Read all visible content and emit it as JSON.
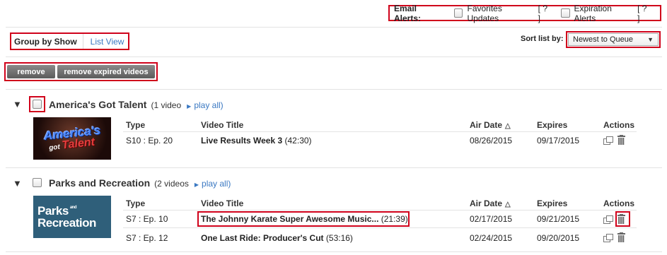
{
  "email_alerts": {
    "label": "Email Alerts:",
    "options": [
      {
        "label": "Favorites Updates",
        "help": "[ ? ]"
      },
      {
        "label": "Expiration Alerts",
        "help": "[ ? ]"
      }
    ]
  },
  "view": {
    "group_by_show": "Group by Show",
    "list_view": "List View"
  },
  "sort": {
    "label": "Sort list by:",
    "selected": "Newest to Queue"
  },
  "actions": {
    "remove": "remove",
    "remove_expired": "remove expired videos"
  },
  "columns": {
    "type": "Type",
    "video_title": "Video Title",
    "air_date": "Air Date",
    "expires": "Expires",
    "actions": "Actions"
  },
  "shows": [
    {
      "title": "America's Got Talent",
      "count": "(1 video",
      "play_all": "play all)",
      "thumb_lines": [
        "America's",
        "got",
        "Talent"
      ],
      "episodes": [
        {
          "type": "S10 : Ep. 20",
          "title": "Live Results Week 3",
          "duration": "(42:30)",
          "air_date": "08/26/2015",
          "expires": "09/17/2015"
        }
      ]
    },
    {
      "title": "Parks and Recreation",
      "count": "(2 videos",
      "play_all": "play all)",
      "thumb_lines": [
        "Parks",
        "and",
        "Recreation"
      ],
      "episodes": [
        {
          "type": "S7 : Ep. 10",
          "title": "The Johnny Karate Super Awesome Music...",
          "duration": "(21:39)",
          "air_date": "02/17/2015",
          "expires": "09/21/2015"
        },
        {
          "type": "S7 : Ep. 12",
          "title": "One Last Ride: Producer's Cut",
          "duration": "(53:16)",
          "air_date": "02/24/2015",
          "expires": "09/20/2015"
        }
      ]
    }
  ]
}
